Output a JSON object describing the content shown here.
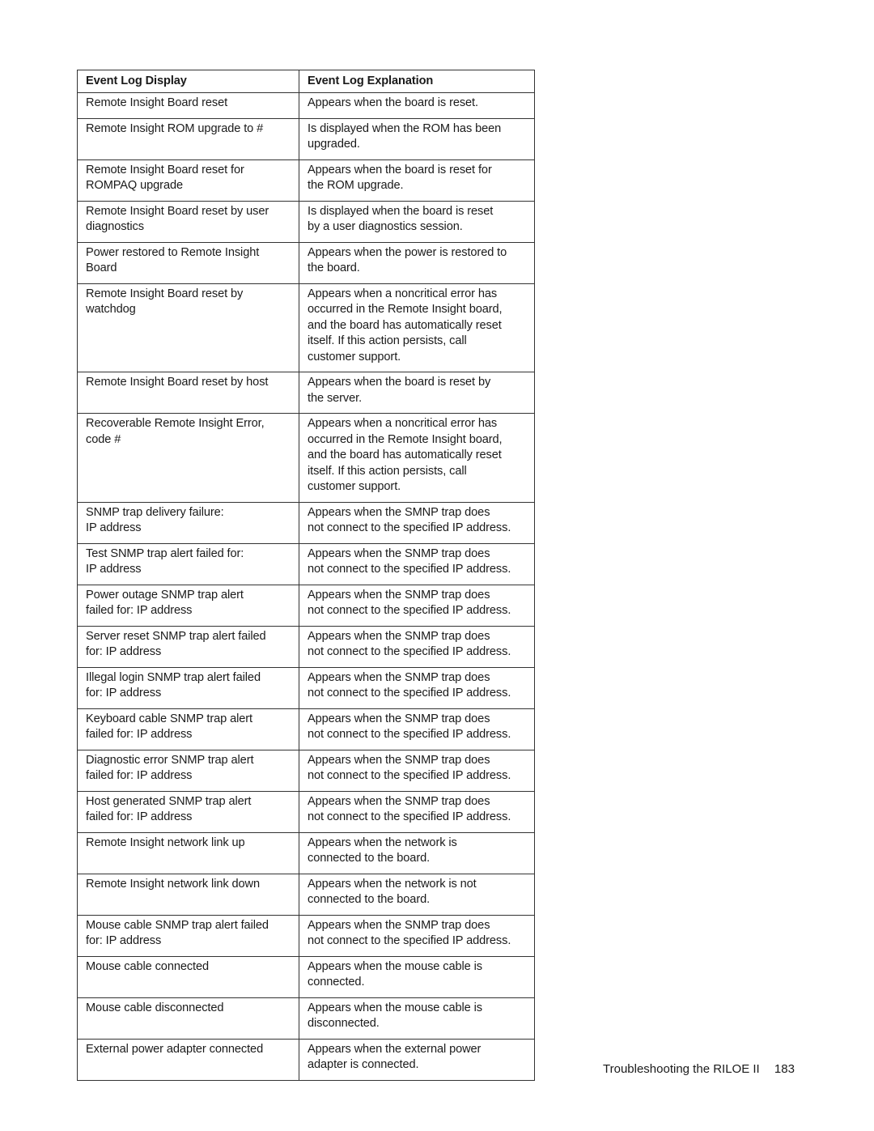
{
  "table": {
    "headers": [
      "Event Log Display",
      "Event Log Explanation"
    ],
    "rows": [
      {
        "display": "Remote Insight Board reset",
        "explanation": "Appears when the board is reset."
      },
      {
        "display": "Remote Insight ROM upgrade to #",
        "explanation": "Is displayed when the ROM has been\nupgraded."
      },
      {
        "display": "Remote Insight Board reset for\nROMPAQ upgrade",
        "explanation": "Appears when the board is reset for\nthe ROM upgrade."
      },
      {
        "display": "Remote Insight Board reset by user\ndiagnostics",
        "explanation": "Is displayed when the board is reset\nby a user diagnostics session."
      },
      {
        "display": "Power restored to Remote Insight\nBoard",
        "explanation": "Appears when the power is restored to\nthe board."
      },
      {
        "display": "Remote Insight Board reset by\nwatchdog",
        "explanation": "Appears when a noncritical error has\noccurred in the Remote Insight board,\nand the board has automatically reset\nitself. If this action persists, call\ncustomer support."
      },
      {
        "display": "Remote Insight Board reset by host",
        "explanation": "Appears when the board is reset by\nthe server."
      },
      {
        "display": "Recoverable Remote Insight Error,\ncode #",
        "explanation": "Appears when a noncritical error has\noccurred in the Remote Insight board,\nand the board has automatically reset\nitself. If this action persists, call\ncustomer support."
      },
      {
        "display": "SNMP trap delivery failure:\nIP address",
        "explanation": "Appears when the SMNP trap does\nnot connect to the specified IP address."
      },
      {
        "display": "Test SNMP trap alert failed for:\nIP address",
        "explanation": "Appears when the SNMP trap does\nnot connect to the specified IP address."
      },
      {
        "display": "Power outage SNMP trap alert\nfailed for: IP address",
        "explanation": "Appears when the SNMP trap does\nnot connect to the specified IP address."
      },
      {
        "display": "Server reset SNMP trap alert failed\nfor: IP address",
        "explanation": "Appears when the SNMP trap does\nnot connect to the specified IP address."
      },
      {
        "display": "Illegal login SNMP trap alert failed\nfor: IP address",
        "explanation": "Appears when the SNMP trap does\nnot connect to the specified IP address."
      },
      {
        "display": "Keyboard cable SNMP trap alert\nfailed for: IP address",
        "explanation": "Appears when the SNMP trap does\nnot connect to the specified IP address."
      },
      {
        "display": "Diagnostic error SNMP trap alert\nfailed for: IP address",
        "explanation": "Appears when the SNMP trap does\nnot connect to the specified IP address."
      },
      {
        "display": "Host generated SNMP trap alert\nfailed for: IP address",
        "explanation": "Appears when the SNMP trap does\nnot connect to the specified IP address."
      },
      {
        "display": "Remote Insight network link up",
        "explanation": "Appears when the network is\nconnected to the board."
      },
      {
        "display": "Remote Insight network link down",
        "explanation": "Appears when the network is not\nconnected to the board."
      },
      {
        "display": "Mouse cable SNMP trap alert failed\nfor: IP address",
        "explanation": "Appears when the SNMP trap does\nnot connect to the specified IP address."
      },
      {
        "display": "Mouse cable connected",
        "explanation": "Appears when the mouse cable is\nconnected."
      },
      {
        "display": "Mouse cable disconnected",
        "explanation": "Appears when the mouse cable is\ndisconnected."
      },
      {
        "display": "External power adapter connected",
        "explanation": "Appears when the external power\nadapter is connected."
      }
    ]
  },
  "footer": {
    "section_title": "Troubleshooting the RILOE II",
    "page_number": "183"
  }
}
